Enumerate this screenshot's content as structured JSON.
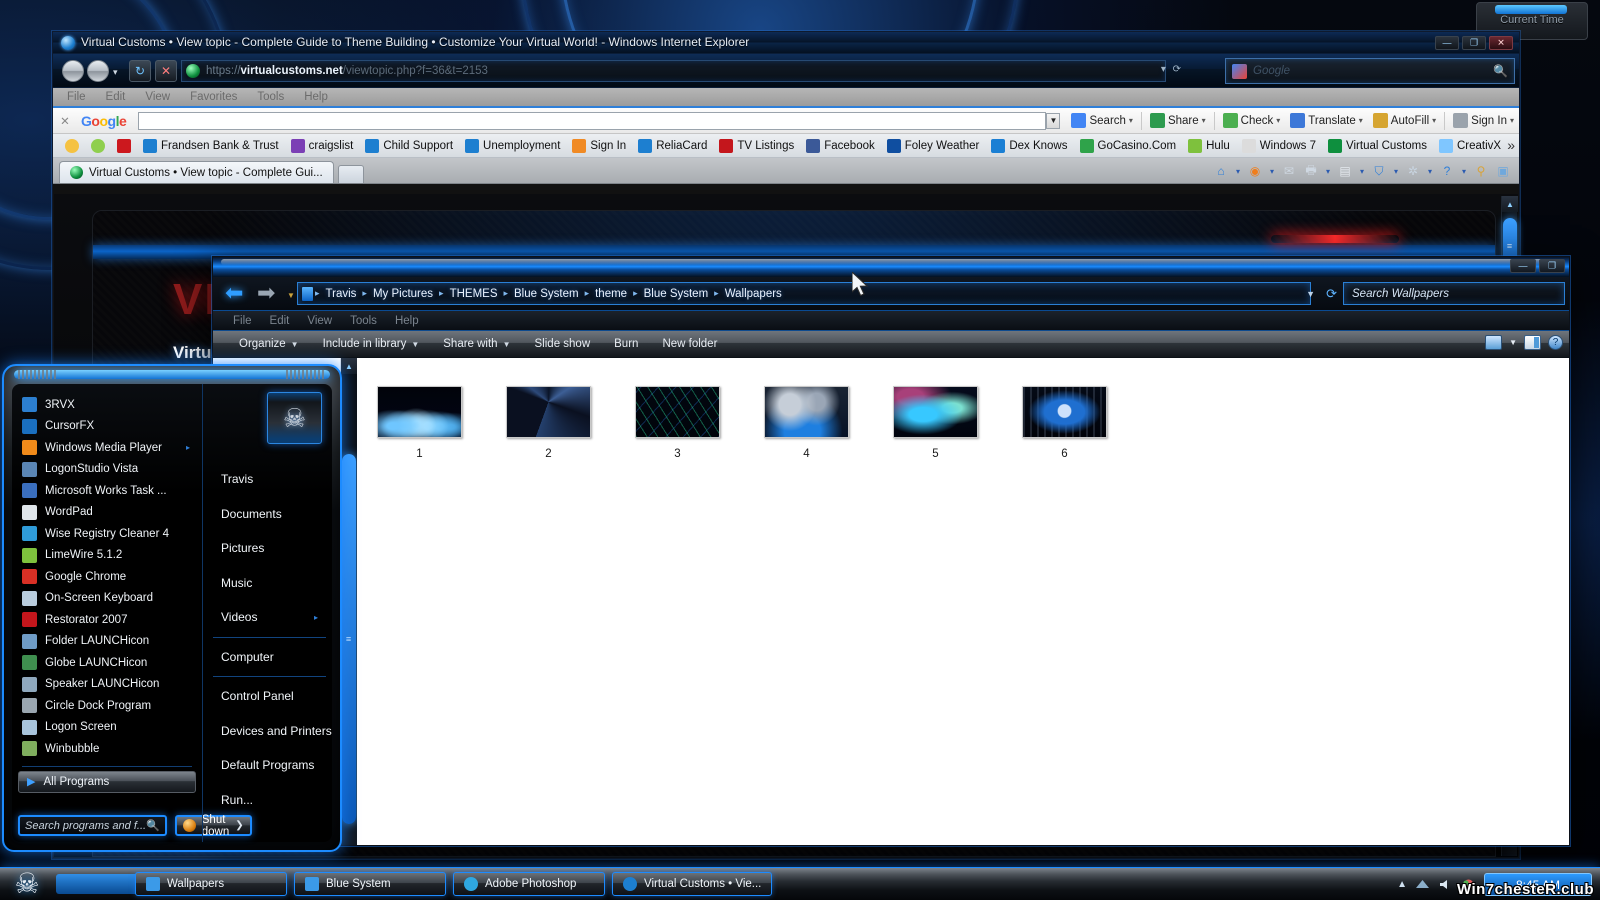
{
  "desktop": {
    "gadget": {
      "title": "Current Time"
    }
  },
  "browser": {
    "title": "Virtual Customs • View topic - Complete Guide to Theme Building • Customize Your Virtual World! - Windows Internet Explorer",
    "window_buttons": {
      "minimize": "—",
      "maximize": "❐",
      "close": "✕"
    },
    "address": {
      "protocol": "https://",
      "host": "virtualcustoms.net",
      "path": "/viewtopic.php?f=36&t=2153"
    },
    "search": {
      "placeholder": "Google",
      "icon": "google-icon"
    },
    "nav": {
      "back": "back-button",
      "forward": "forward-button",
      "refresh": "↻",
      "stop": "✕"
    },
    "menu": [
      "File",
      "Edit",
      "View",
      "Favorites",
      "Tools",
      "Help"
    ],
    "google_toolbar": {
      "logo": [
        {
          "c": "b",
          "t": "G"
        },
        {
          "c": "r",
          "t": "o"
        },
        {
          "c": "y",
          "t": "o"
        },
        {
          "c": "b",
          "t": "g"
        },
        {
          "c": "g",
          "t": "l"
        },
        {
          "c": "r",
          "t": "e"
        }
      ],
      "items": [
        {
          "label": "Search",
          "icon": "google-search-icon",
          "color": "#4285f4",
          "caret": "▾"
        },
        {
          "label": "Share",
          "icon": "share-icon",
          "color": "#2e9b4f",
          "caret": "▾"
        },
        {
          "label": "Check",
          "icon": "spellcheck-icon",
          "color": "#4caf50",
          "caret": "▾"
        },
        {
          "label": "Translate",
          "icon": "translate-icon",
          "color": "#3d78d8",
          "caret": "▾"
        },
        {
          "label": "AutoFill",
          "icon": "autofill-icon",
          "color": "#d6a531",
          "caret": "▾"
        },
        {
          "label": "Sign In",
          "icon": "signin-icon",
          "color": "#9aa3ac",
          "caret": "▾"
        }
      ]
    },
    "favorites": [
      {
        "label": "",
        "icon": "favorites-star-icon",
        "color": "#f5c242"
      },
      {
        "label": "",
        "icon": "add-favorite-icon",
        "color": "#8fcf4e"
      },
      {
        "label": "",
        "icon": "youtube-icon",
        "color": "#cc181e"
      },
      {
        "label": "Frandsen Bank & Trust",
        "icon": "ie-icon",
        "color": "#1d7fd0"
      },
      {
        "label": "craigslist",
        "icon": "craigslist-icon",
        "color": "#7b3fb5"
      },
      {
        "label": "Child Support",
        "icon": "ie-icon",
        "color": "#1d7fd0"
      },
      {
        "label": "Unemployment",
        "icon": "ie-icon",
        "color": "#1d7fd0"
      },
      {
        "label": "Sign In",
        "icon": "signin-icon",
        "color": "#f08a24"
      },
      {
        "label": "ReliaCard",
        "icon": "ie-icon",
        "color": "#1d7fd0"
      },
      {
        "label": "TV Listings",
        "icon": "tvguide-icon",
        "color": "#c4161c"
      },
      {
        "label": "Facebook",
        "icon": "facebook-icon",
        "color": "#3b5998"
      },
      {
        "label": "Foley Weather",
        "icon": "twc-icon",
        "color": "#0f4ea0"
      },
      {
        "label": "Dex Knows",
        "icon": "dexknows-icon",
        "color": "#1a7fd4"
      },
      {
        "label": "GoCasino.Com",
        "icon": "ie-icon",
        "color": "#2fa34a"
      },
      {
        "label": "Hulu",
        "icon": "hulu-icon",
        "color": "#7ec13d"
      },
      {
        "label": "Windows 7",
        "icon": "windows7-icon",
        "color": "#dcdcdc"
      },
      {
        "label": "Virtual Customs",
        "icon": "virtualcustoms-icon",
        "color": "#0e8f3e"
      },
      {
        "label": "CreativX",
        "icon": "creativx-icon",
        "color": "#7fc6ff"
      }
    ],
    "favorites_overflow": "»",
    "tab": {
      "label": "Virtual Customs • View topic - Complete Gui...",
      "icon": "virtualcustoms-icon"
    },
    "new_tab": "new-tab-button",
    "command_icons": [
      {
        "name": "home-icon",
        "glyph": "⌂",
        "color": "#2f7fd8",
        "caret": "▾"
      },
      {
        "name": "rss-feeds-icon",
        "glyph": "◉",
        "color": "#f07d1a",
        "caret": "▾"
      },
      {
        "name": "read-mail-icon",
        "glyph": "✉",
        "color": "#cfd8e2",
        "caret": ""
      },
      {
        "name": "print-icon",
        "glyph": "🖶",
        "color": "#cfd8e2",
        "caret": "▾"
      },
      {
        "name": "page-icon",
        "glyph": "▤",
        "color": "#e4e9ee",
        "caret": "▾"
      },
      {
        "name": "safety-shield-icon",
        "glyph": "⛉",
        "color": "#2f7fd8",
        "caret": "▾"
      },
      {
        "name": "tools-gear-icon",
        "glyph": "✲",
        "color": "#c8d4e0",
        "caret": "▾"
      },
      {
        "name": "help-icon",
        "glyph": "?",
        "color": "#2f7fd8",
        "caret": "▾"
      },
      {
        "name": "research-icon",
        "glyph": "⚲",
        "color": "#d8a33a",
        "caret": ""
      },
      {
        "name": "snagit-icon",
        "glyph": "▣",
        "color": "#6fa8dc",
        "caret": ""
      }
    ],
    "page": {
      "logo_text": "VIR",
      "site_name": "Virtual Cus"
    }
  },
  "explorer": {
    "window_buttons": {
      "minimize": "—",
      "restore": "❐"
    },
    "breadcrumbs": [
      "Travis",
      "My Pictures",
      "THEMES",
      "Blue System",
      "theme",
      "Blue System",
      "Wallpapers"
    ],
    "crumb_separator": "▸",
    "search_placeholder": "Search Wallpapers",
    "menu": [
      "File",
      "Edit",
      "View",
      "Tools",
      "Help"
    ],
    "commands": [
      {
        "label": "Organize",
        "caret": "▼"
      },
      {
        "label": "Include in library",
        "caret": "▼"
      },
      {
        "label": "Share with",
        "caret": "▼"
      },
      {
        "label": "Slide show",
        "caret": ""
      },
      {
        "label": "Burn",
        "caret": ""
      },
      {
        "label": "New folder",
        "caret": ""
      }
    ],
    "right_controls": [
      {
        "name": "change-view-icon",
        "caret": "▼"
      },
      {
        "name": "show-preview-pane-icon",
        "caret": ""
      },
      {
        "name": "help-icon",
        "glyph": "?"
      }
    ],
    "files": [
      {
        "name": "1",
        "thumb": "t1"
      },
      {
        "name": "2",
        "thumb": "t2"
      },
      {
        "name": "3",
        "thumb": "t3"
      },
      {
        "name": "4",
        "thumb": "t4"
      },
      {
        "name": "5",
        "thumb": "t5"
      },
      {
        "name": "6",
        "thumb": "t6"
      }
    ]
  },
  "start_menu": {
    "programs": [
      {
        "label": "3RVX",
        "icon": "3rvx-icon",
        "color": "#2c7fd0",
        "submenu": ""
      },
      {
        "label": "CursorFX",
        "icon": "cursorfx-icon",
        "color": "#1a6fbf",
        "submenu": ""
      },
      {
        "label": "Windows Media Player",
        "icon": "windows-media-player-icon",
        "color": "#f08a1a",
        "submenu": "▸"
      },
      {
        "label": "LogonStudio Vista",
        "icon": "logonstudio-icon",
        "color": "#5a86b5",
        "submenu": ""
      },
      {
        "label": "Microsoft Works Task ...",
        "icon": "microsoft-works-icon",
        "color": "#3a6fbf",
        "submenu": ""
      },
      {
        "label": "WordPad",
        "icon": "wordpad-icon",
        "color": "#dfe5ea",
        "submenu": ""
      },
      {
        "label": "Wise Registry Cleaner 4",
        "icon": "wise-registry-cleaner-icon",
        "color": "#2f9bd8",
        "submenu": ""
      },
      {
        "label": "LimeWire 5.1.2",
        "icon": "limewire-icon",
        "color": "#7ec13d",
        "submenu": ""
      },
      {
        "label": "Google Chrome",
        "icon": "google-chrome-icon",
        "color": "#d93025",
        "submenu": ""
      },
      {
        "label": "On-Screen Keyboard",
        "icon": "on-screen-keyboard-icon",
        "color": "#b9ccdd",
        "submenu": ""
      },
      {
        "label": "Restorator 2007",
        "icon": "restorator-icon",
        "color": "#c4161c",
        "submenu": ""
      },
      {
        "label": "Folder LAUNCHicon",
        "icon": "folder-launchicon",
        "color": "#6f9cc6",
        "submenu": ""
      },
      {
        "label": "Globe LAUNCHicon",
        "icon": "globe-launchicon",
        "color": "#3f8f4f",
        "submenu": ""
      },
      {
        "label": "Speaker LAUNCHicon",
        "icon": "speaker-launchicon",
        "color": "#8fa8bd",
        "submenu": ""
      },
      {
        "label": "Circle Dock Program",
        "icon": "circle-dock-icon",
        "color": "#9aa6b0",
        "submenu": ""
      },
      {
        "label": "Logon Screen",
        "icon": "logon-screen-icon",
        "color": "#a8c4dc",
        "submenu": ""
      },
      {
        "label": "Winbubble",
        "icon": "winbubble-icon",
        "color": "#7fae5e",
        "submenu": ""
      }
    ],
    "all_programs": {
      "label": "All Programs",
      "arrow": "▶"
    },
    "search": {
      "placeholder": "Search programs and f...",
      "icon": "search-magnifier-icon"
    },
    "shutdown": {
      "label": "Shut down",
      "arrow": "❯",
      "icon": "shield-icon"
    },
    "avatar": {
      "name": "user-avatar",
      "glyph": "☠"
    },
    "places": [
      {
        "label": "Travis",
        "submenu": ""
      },
      {
        "label": "Documents",
        "submenu": ""
      },
      {
        "label": "Pictures",
        "submenu": ""
      },
      {
        "label": "Music",
        "submenu": ""
      },
      {
        "label": "Videos",
        "submenu": "▸"
      },
      {
        "label": "Computer",
        "submenu": ""
      },
      {
        "label": "Control Panel",
        "submenu": ""
      },
      {
        "label": "Devices and Printers",
        "submenu": ""
      },
      {
        "label": "Default Programs",
        "submenu": ""
      },
      {
        "label": "Run...",
        "submenu": ""
      }
    ]
  },
  "taskbar": {
    "start_orb": "start-orb-skull-icon",
    "buttons": [
      {
        "label": "Wallpapers",
        "icon": "folder-icon",
        "color": "#3b9ae8"
      },
      {
        "label": "Blue System",
        "icon": "folder-icon",
        "color": "#3b9ae8"
      },
      {
        "label": "Adobe Photoshop",
        "icon": "adobe-photoshop-icon",
        "color": "#2fa7e0"
      },
      {
        "label": "Virtual Customs • Vie...",
        "icon": "ie-icon",
        "color": "#1d7fd0"
      }
    ],
    "tray": {
      "overflow": "▲",
      "icons": [
        "network-icon",
        "volume-icon",
        "action-center-icon"
      ]
    },
    "clock": "8:45 AM",
    "watermark": "Win7chesteR.club"
  }
}
